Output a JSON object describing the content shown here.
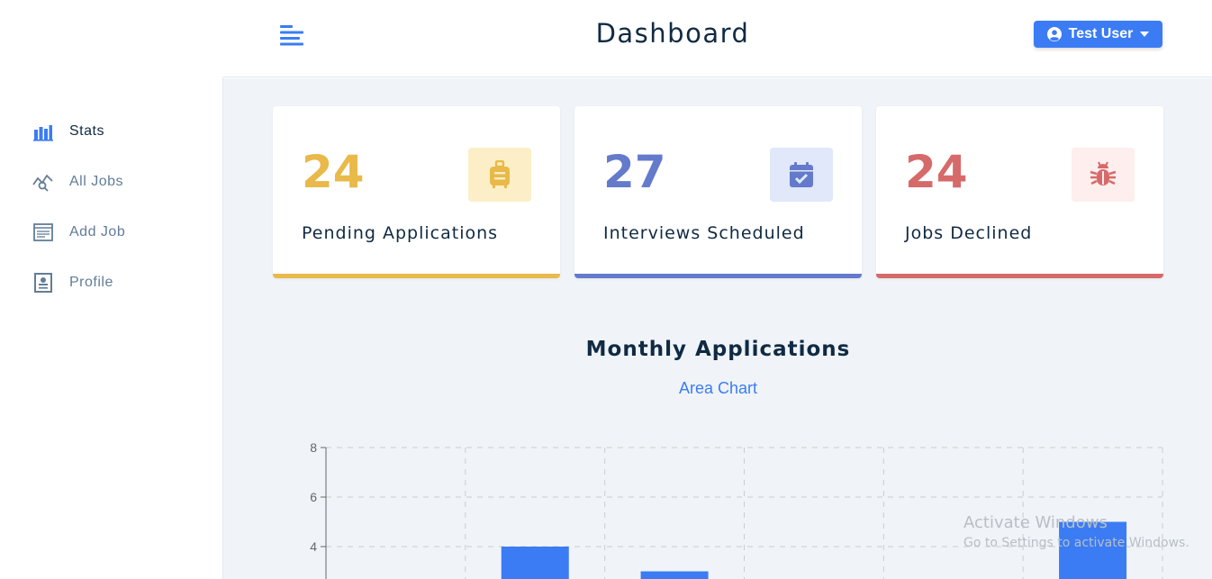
{
  "header": {
    "title": "Dashboard",
    "user_label": "Test User"
  },
  "sidebar": {
    "items": [
      {
        "label": "Stats",
        "icon": "bar-chart-icon",
        "active": true
      },
      {
        "label": "All Jobs",
        "icon": "query-stats-icon",
        "active": false
      },
      {
        "label": "Add Job",
        "icon": "form-icon",
        "active": false
      },
      {
        "label": "Profile",
        "icon": "id-card-icon",
        "active": false
      }
    ]
  },
  "stats": [
    {
      "count": "24",
      "label": "Pending Applications",
      "icon": "suitcase-icon",
      "color": "#e9b949",
      "bg": "#fcefc7"
    },
    {
      "count": "27",
      "label": "Interviews Scheduled",
      "icon": "calendar-check-icon",
      "color": "#647acb",
      "bg": "#e0e8f9"
    },
    {
      "count": "24",
      "label": "Jobs Declined",
      "icon": "bug-icon",
      "color": "#d66a6a",
      "bg": "#ffeeee"
    }
  ],
  "chart": {
    "title": "Monthly Applications",
    "toggle_label": "Area Chart"
  },
  "chart_data": {
    "type": "bar",
    "categories": [
      "",
      "",
      "",
      "",
      "",
      ""
    ],
    "values": [
      0,
      4,
      3,
      0,
      0,
      5
    ],
    "ylim": [
      0,
      8
    ],
    "yticks": [
      4,
      6,
      8
    ],
    "grid": true,
    "bar_color": "#3b7cf4"
  },
  "watermark": {
    "line1": "Activate Windows",
    "line2": "Go to Settings to activate Windows."
  }
}
